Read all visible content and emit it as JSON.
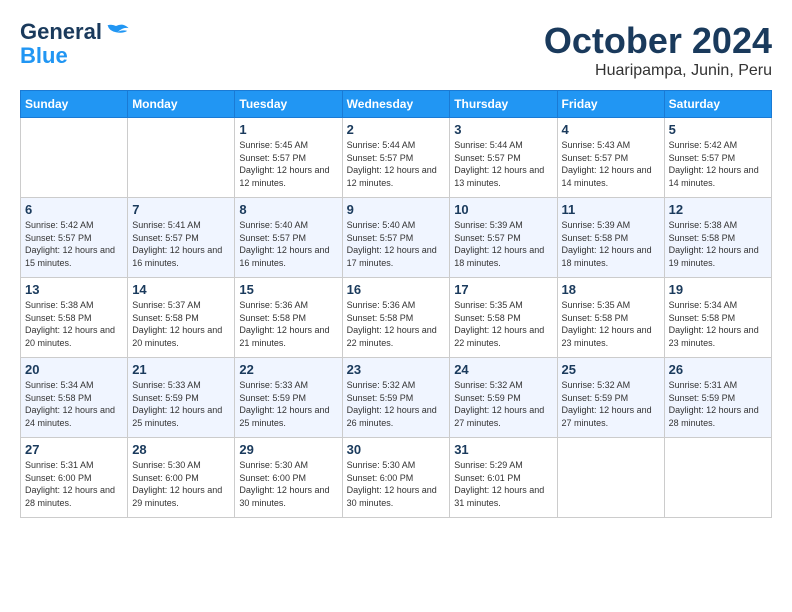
{
  "header": {
    "logo_line1": "General",
    "logo_line2": "Blue",
    "month": "October 2024",
    "location": "Huaripampa, Junin, Peru"
  },
  "weekdays": [
    "Sunday",
    "Monday",
    "Tuesday",
    "Wednesday",
    "Thursday",
    "Friday",
    "Saturday"
  ],
  "weeks": [
    [
      {
        "day": "",
        "info": ""
      },
      {
        "day": "",
        "info": ""
      },
      {
        "day": "1",
        "info": "Sunrise: 5:45 AM\nSunset: 5:57 PM\nDaylight: 12 hours and 12 minutes."
      },
      {
        "day": "2",
        "info": "Sunrise: 5:44 AM\nSunset: 5:57 PM\nDaylight: 12 hours and 12 minutes."
      },
      {
        "day": "3",
        "info": "Sunrise: 5:44 AM\nSunset: 5:57 PM\nDaylight: 12 hours and 13 minutes."
      },
      {
        "day": "4",
        "info": "Sunrise: 5:43 AM\nSunset: 5:57 PM\nDaylight: 12 hours and 14 minutes."
      },
      {
        "day": "5",
        "info": "Sunrise: 5:42 AM\nSunset: 5:57 PM\nDaylight: 12 hours and 14 minutes."
      }
    ],
    [
      {
        "day": "6",
        "info": "Sunrise: 5:42 AM\nSunset: 5:57 PM\nDaylight: 12 hours and 15 minutes."
      },
      {
        "day": "7",
        "info": "Sunrise: 5:41 AM\nSunset: 5:57 PM\nDaylight: 12 hours and 16 minutes."
      },
      {
        "day": "8",
        "info": "Sunrise: 5:40 AM\nSunset: 5:57 PM\nDaylight: 12 hours and 16 minutes."
      },
      {
        "day": "9",
        "info": "Sunrise: 5:40 AM\nSunset: 5:57 PM\nDaylight: 12 hours and 17 minutes."
      },
      {
        "day": "10",
        "info": "Sunrise: 5:39 AM\nSunset: 5:57 PM\nDaylight: 12 hours and 18 minutes."
      },
      {
        "day": "11",
        "info": "Sunrise: 5:39 AM\nSunset: 5:58 PM\nDaylight: 12 hours and 18 minutes."
      },
      {
        "day": "12",
        "info": "Sunrise: 5:38 AM\nSunset: 5:58 PM\nDaylight: 12 hours and 19 minutes."
      }
    ],
    [
      {
        "day": "13",
        "info": "Sunrise: 5:38 AM\nSunset: 5:58 PM\nDaylight: 12 hours and 20 minutes."
      },
      {
        "day": "14",
        "info": "Sunrise: 5:37 AM\nSunset: 5:58 PM\nDaylight: 12 hours and 20 minutes."
      },
      {
        "day": "15",
        "info": "Sunrise: 5:36 AM\nSunset: 5:58 PM\nDaylight: 12 hours and 21 minutes."
      },
      {
        "day": "16",
        "info": "Sunrise: 5:36 AM\nSunset: 5:58 PM\nDaylight: 12 hours and 22 minutes."
      },
      {
        "day": "17",
        "info": "Sunrise: 5:35 AM\nSunset: 5:58 PM\nDaylight: 12 hours and 22 minutes."
      },
      {
        "day": "18",
        "info": "Sunrise: 5:35 AM\nSunset: 5:58 PM\nDaylight: 12 hours and 23 minutes."
      },
      {
        "day": "19",
        "info": "Sunrise: 5:34 AM\nSunset: 5:58 PM\nDaylight: 12 hours and 23 minutes."
      }
    ],
    [
      {
        "day": "20",
        "info": "Sunrise: 5:34 AM\nSunset: 5:58 PM\nDaylight: 12 hours and 24 minutes."
      },
      {
        "day": "21",
        "info": "Sunrise: 5:33 AM\nSunset: 5:59 PM\nDaylight: 12 hours and 25 minutes."
      },
      {
        "day": "22",
        "info": "Sunrise: 5:33 AM\nSunset: 5:59 PM\nDaylight: 12 hours and 25 minutes."
      },
      {
        "day": "23",
        "info": "Sunrise: 5:32 AM\nSunset: 5:59 PM\nDaylight: 12 hours and 26 minutes."
      },
      {
        "day": "24",
        "info": "Sunrise: 5:32 AM\nSunset: 5:59 PM\nDaylight: 12 hours and 27 minutes."
      },
      {
        "day": "25",
        "info": "Sunrise: 5:32 AM\nSunset: 5:59 PM\nDaylight: 12 hours and 27 minutes."
      },
      {
        "day": "26",
        "info": "Sunrise: 5:31 AM\nSunset: 5:59 PM\nDaylight: 12 hours and 28 minutes."
      }
    ],
    [
      {
        "day": "27",
        "info": "Sunrise: 5:31 AM\nSunset: 6:00 PM\nDaylight: 12 hours and 28 minutes."
      },
      {
        "day": "28",
        "info": "Sunrise: 5:30 AM\nSunset: 6:00 PM\nDaylight: 12 hours and 29 minutes."
      },
      {
        "day": "29",
        "info": "Sunrise: 5:30 AM\nSunset: 6:00 PM\nDaylight: 12 hours and 30 minutes."
      },
      {
        "day": "30",
        "info": "Sunrise: 5:30 AM\nSunset: 6:00 PM\nDaylight: 12 hours and 30 minutes."
      },
      {
        "day": "31",
        "info": "Sunrise: 5:29 AM\nSunset: 6:01 PM\nDaylight: 12 hours and 31 minutes."
      },
      {
        "day": "",
        "info": ""
      },
      {
        "day": "",
        "info": ""
      }
    ]
  ]
}
